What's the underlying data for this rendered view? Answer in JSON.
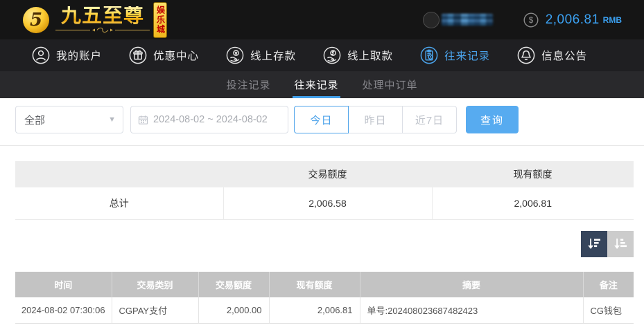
{
  "header": {
    "logo": {
      "emblem": "5",
      "title": "九五至尊",
      "badge": "娱乐城"
    },
    "balance": {
      "currency_symbol": "$",
      "amount": "2,006.81",
      "currency": "RMB"
    }
  },
  "nav": {
    "items": [
      {
        "label": "我的账户",
        "icon": "user-icon",
        "active": false
      },
      {
        "label": "优惠中心",
        "icon": "gift-icon",
        "active": false
      },
      {
        "label": "线上存款",
        "icon": "deposit-icon",
        "active": false
      },
      {
        "label": "线上取款",
        "icon": "withdraw-icon",
        "active": false
      },
      {
        "label": "往来记录",
        "icon": "records-icon",
        "active": true
      },
      {
        "label": "信息公告",
        "icon": "bell-icon",
        "active": false
      }
    ]
  },
  "subtabs": {
    "items": [
      {
        "label": "投注记录",
        "active": false
      },
      {
        "label": "往来记录",
        "active": true
      },
      {
        "label": "处理中订单",
        "active": false
      }
    ]
  },
  "filters": {
    "type_select": {
      "value": "全部"
    },
    "date_range": {
      "value": "2024-08-02 ~ 2024-08-02"
    },
    "quick_buttons": [
      {
        "label": "今日",
        "active": true
      },
      {
        "label": "昨日",
        "active": false
      },
      {
        "label": "近7日",
        "active": false
      }
    ],
    "search_label": "查询"
  },
  "summary_table": {
    "headers": [
      "",
      "交易额度",
      "现有额度"
    ],
    "rows": [
      [
        "总计",
        "2,006.58",
        "2,006.81"
      ]
    ]
  },
  "records_table": {
    "headers": [
      "时间",
      "交易类别",
      "交易额度",
      "现有额度",
      "摘要",
      "备注"
    ],
    "rows": [
      [
        "2024-08-02 07:30:06",
        "CGPAY支付",
        "2,000.00",
        "2,006.81",
        "单号:202408023687482423",
        "CG钱包"
      ]
    ]
  },
  "colors": {
    "accent_blue": "#4ba4ec",
    "button_blue": "#57abf0",
    "balance_blue": "#3ba1f2",
    "top_bar_bg": "#151515",
    "nav_bar_bg": "#1f1f22",
    "subtab_bar_bg": "#29292c",
    "table_header_gray": "#c3c3c3",
    "summary_header_gray": "#ededed",
    "sort_active_navy": "#36455c",
    "sort_inactive_gray": "#cccccc",
    "logo_gold": "#fccb33",
    "badge_red": "#c00000"
  }
}
